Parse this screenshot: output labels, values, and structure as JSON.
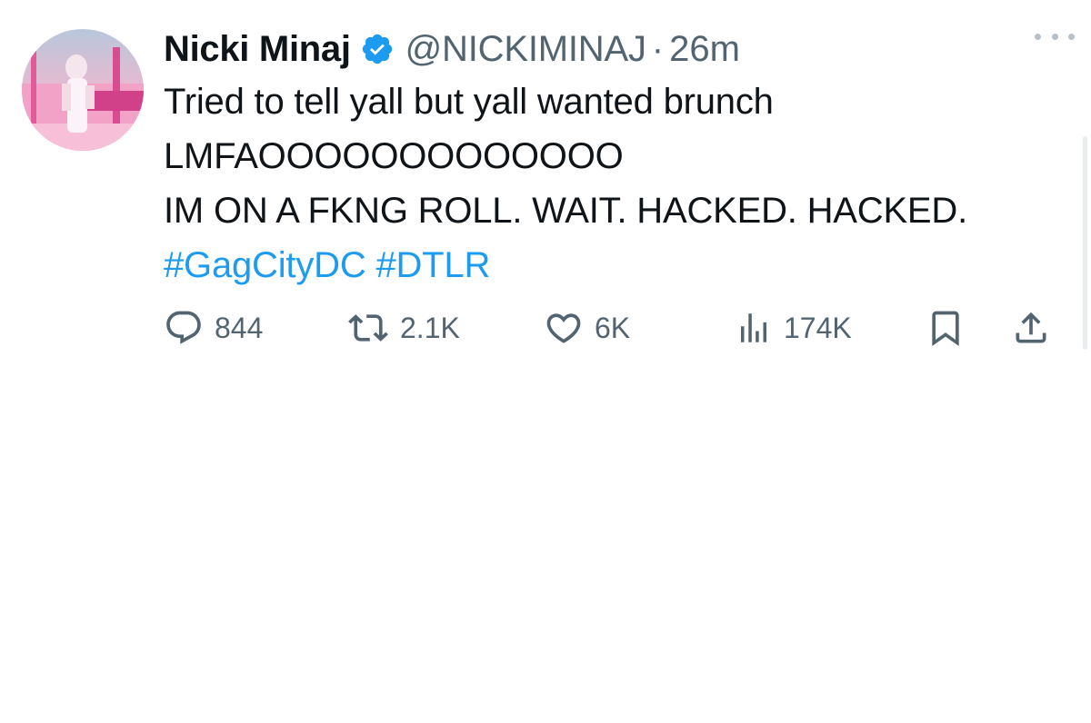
{
  "tweet": {
    "display_name": "Nicki Minaj",
    "handle": "@NICKIMINAJ",
    "separator": "·",
    "time": "26m",
    "text_lines": [
      "Tried to tell yall but yall wanted brunch",
      "LMFAOOOOOOOOOOOOO",
      "IM ON A FKNG ROLL. WAIT. HACKED. HACKED."
    ],
    "hashtags": [
      "#GagCityDC",
      "#DTLR"
    ],
    "verified": true
  },
  "actions": {
    "replies": "844",
    "retweets": "2.1K",
    "likes": "6K",
    "views": "174K"
  },
  "icons": {
    "verified": "verified-badge-icon",
    "reply": "reply-icon",
    "retweet": "retweet-icon",
    "like": "heart-icon",
    "views": "views-icon",
    "bookmark": "bookmark-icon",
    "share": "share-icon",
    "more": "more-icon"
  },
  "colors": {
    "accent": "#1d9bf0",
    "muted": "#536471",
    "text": "#0f1419"
  }
}
